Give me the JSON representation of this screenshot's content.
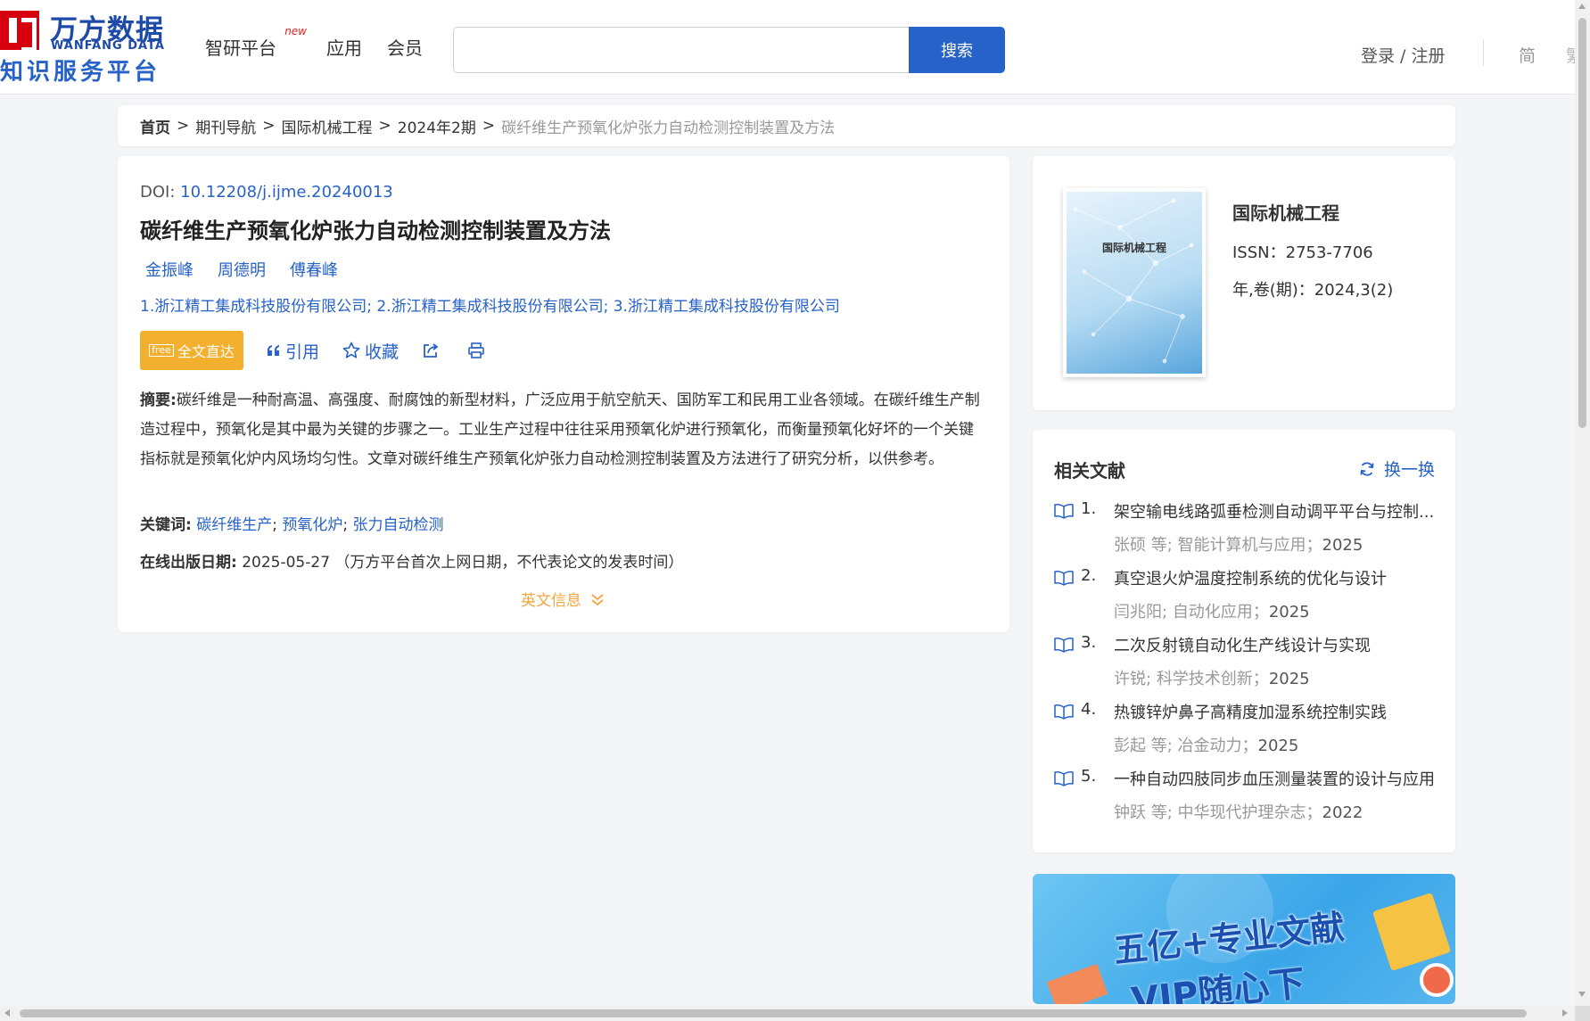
{
  "header": {
    "logo_cn": "万方数据",
    "logo_en": "WANFANG DATA",
    "logo_sub": "知识服务平台",
    "nav": [
      {
        "label": "智研平台",
        "badge": "new"
      },
      {
        "label": "应用"
      },
      {
        "label": "会员"
      }
    ],
    "search_value": "",
    "search_button": "搜索",
    "login": "登录 / 注册",
    "lang_simplified": "简",
    "lang_traditional": "繁"
  },
  "breadcrumb": {
    "items": [
      "首页",
      "期刊导航",
      "国际机械工程",
      "2024年2期"
    ],
    "separator": ">",
    "current": "碳纤维生产预氧化炉张力自动检测控制装置及方法"
  },
  "article": {
    "doi_label": "DOI:",
    "doi": "10.12208/j.ijme.20240013",
    "title": "碳纤维生产预氧化炉张力自动检测控制装置及方法",
    "authors": [
      "金振峰",
      "周德明",
      "傅春峰"
    ],
    "affiliations": "1.浙江精工集成科技股份有限公司; 2.浙江精工集成科技股份有限公司; 3.浙江精工集成科技股份有限公司",
    "actions": {
      "fulltext_icon": "free",
      "fulltext": "全文直达",
      "cite": "引用",
      "favorite": "收藏"
    },
    "abstract_label": "摘要:",
    "abstract": "碳纤维是一种耐高温、高强度、耐腐蚀的新型材料，广泛应用于航空航天、国防军工和民用工业各领域。在碳纤维生产制造过程中，预氧化是其中最为关键的步骤之一。工业生产过程中往往采用预氧化炉进行预氧化，而衡量预氧化好坏的一个关键指标就是预氧化炉内风场均匀性。文章对碳纤维生产预氧化炉张力自动检测控制装置及方法进行了研究分析，以供参考。",
    "keywords_label": "关键词:",
    "keywords": [
      "碳纤维生产",
      "预氧化炉",
      "张力自动检测"
    ],
    "keyword_sep": ";",
    "pubdate_label": "在线出版日期:",
    "pubdate": "2025-05-27",
    "pubdate_note": "（万方平台首次上网日期，不代表论文的发表时间）",
    "en_info": "英文信息"
  },
  "journal": {
    "cover_title": "国际机械工程",
    "name": "国际机械工程",
    "issn": "ISSN：2753-7706",
    "volume": "年,卷(期)：2024,3(2)"
  },
  "related": {
    "title": "相关文献",
    "refresh": "换一换",
    "items": [
      {
        "num": "1.",
        "title": "架空输电线路弧垂检测自动调平平台与控制...",
        "authors": "张硕 等;",
        "source": "智能计算机与应用；",
        "year": "2025"
      },
      {
        "num": "2.",
        "title": "真空退火炉温度控制系统的优化与设计",
        "authors": "闫兆阳;",
        "source": "自动化应用；",
        "year": "2025"
      },
      {
        "num": "3.",
        "title": "二次反射镜自动化生产线设计与实现",
        "authors": "许锐;",
        "source": "科学技术创新；",
        "year": "2025"
      },
      {
        "num": "4.",
        "title": "热镀锌炉鼻子高精度加湿系统控制实践",
        "authors": "彭起 等;",
        "source": "冶金动力；",
        "year": "2025"
      },
      {
        "num": "5.",
        "title": "一种自动四肢同步血压测量装置的设计与应用",
        "authors": "钟跃 等;",
        "source": "中华现代护理杂志；",
        "year": "2022"
      }
    ]
  },
  "banner": {
    "line1": "五亿+专业文献",
    "line2": "VIP随心下"
  }
}
